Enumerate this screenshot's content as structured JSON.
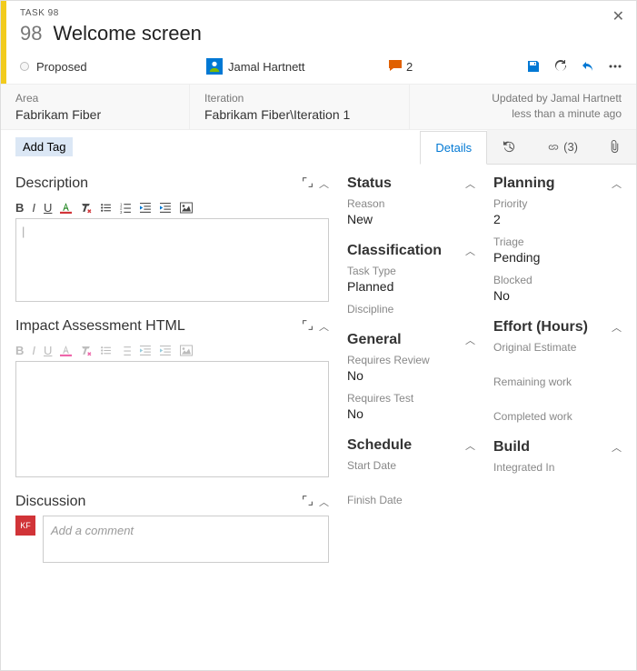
{
  "header": {
    "task_label": "TASK 98",
    "id": "98",
    "title": "Welcome screen"
  },
  "state": {
    "label": "Proposed"
  },
  "assignee": {
    "name": "Jamal Hartnett"
  },
  "comments": {
    "count": "2"
  },
  "meta": {
    "area_label": "Area",
    "area_value": "Fabrikam Fiber",
    "iteration_label": "Iteration",
    "iteration_value": "Fabrikam Fiber\\Iteration 1",
    "updated_by": "Updated by Jamal Hartnett",
    "updated_when": "less than a minute ago"
  },
  "tags": {
    "add_label": "Add Tag"
  },
  "tabs": {
    "details": "Details",
    "links": "(3)"
  },
  "left": {
    "description_title": "Description",
    "impact_title": "Impact Assessment HTML",
    "discussion_title": "Discussion",
    "discussion_placeholder": "Add a comment",
    "discussion_avatar": "KF"
  },
  "mid": {
    "status_title": "Status",
    "reason_label": "Reason",
    "reason_value": "New",
    "classification_title": "Classification",
    "tasktype_label": "Task Type",
    "tasktype_value": "Planned",
    "discipline_label": "Discipline",
    "general_title": "General",
    "reqreview_label": "Requires Review",
    "reqreview_value": "No",
    "reqtest_label": "Requires Test",
    "reqtest_value": "No",
    "schedule_title": "Schedule",
    "startdate_label": "Start Date",
    "finishdate_label": "Finish Date"
  },
  "right": {
    "planning_title": "Planning",
    "priority_label": "Priority",
    "priority_value": "2",
    "triage_label": "Triage",
    "triage_value": "Pending",
    "blocked_label": "Blocked",
    "blocked_value": "No",
    "effort_title": "Effort (Hours)",
    "origest_label": "Original Estimate",
    "remaining_label": "Remaining work",
    "completed_label": "Completed work",
    "build_title": "Build",
    "integrated_label": "Integrated In"
  }
}
